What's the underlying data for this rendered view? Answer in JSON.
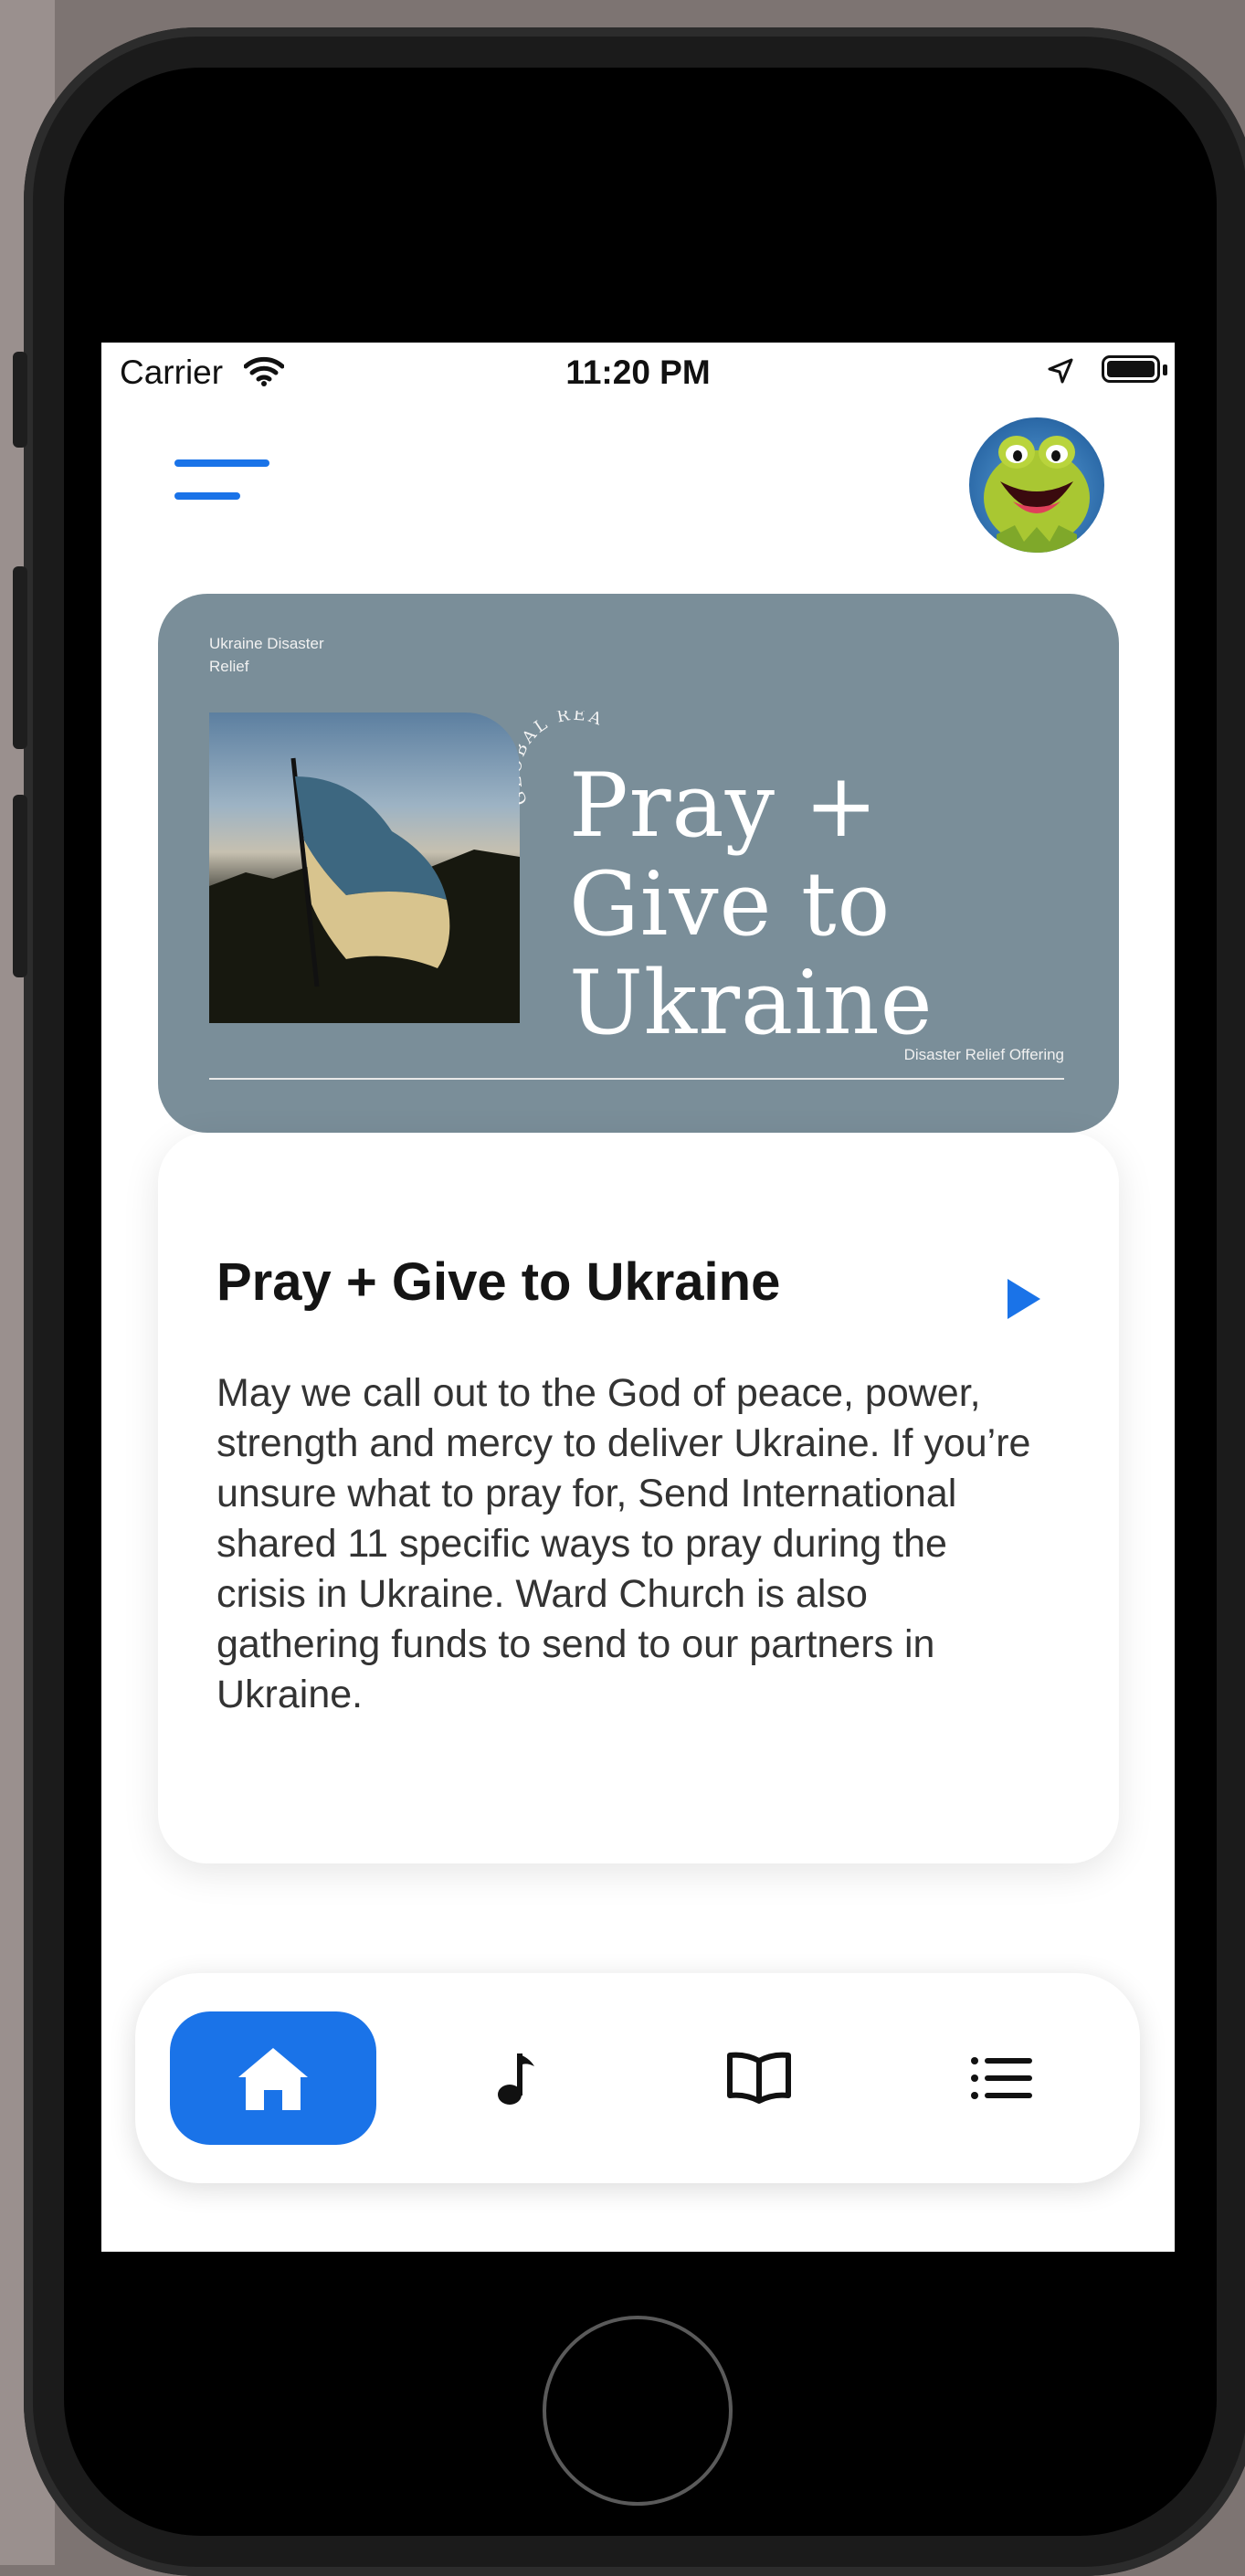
{
  "status_bar": {
    "carrier": "Carrier",
    "time": "11:20 PM"
  },
  "banner": {
    "tag": "Ukraine Disaster Relief",
    "curved_text": "GLOBAL REACH",
    "title": "Pray + Give to Ukraine",
    "footer": "Disaster Relief Offering",
    "background_color": "#7a8e99"
  },
  "card": {
    "title": "Pray + Give to Ukraine",
    "body": "May we call out to the God of peace, power, strength and mercy to deliver Ukraine. If you’re unsure what to pray for, Send International shared 11 specific ways to pray during the crisis in Ukraine. Ward Church is also gathering funds to send to our partners in Ukraine."
  },
  "nav": {
    "items": [
      {
        "icon": "home-icon",
        "active": true
      },
      {
        "icon": "music-note-icon",
        "active": false
      },
      {
        "icon": "book-icon",
        "active": false
      },
      {
        "icon": "list-icon",
        "active": false
      }
    ]
  },
  "colors": {
    "accent": "#1a73e8",
    "card_text": "#333333"
  }
}
